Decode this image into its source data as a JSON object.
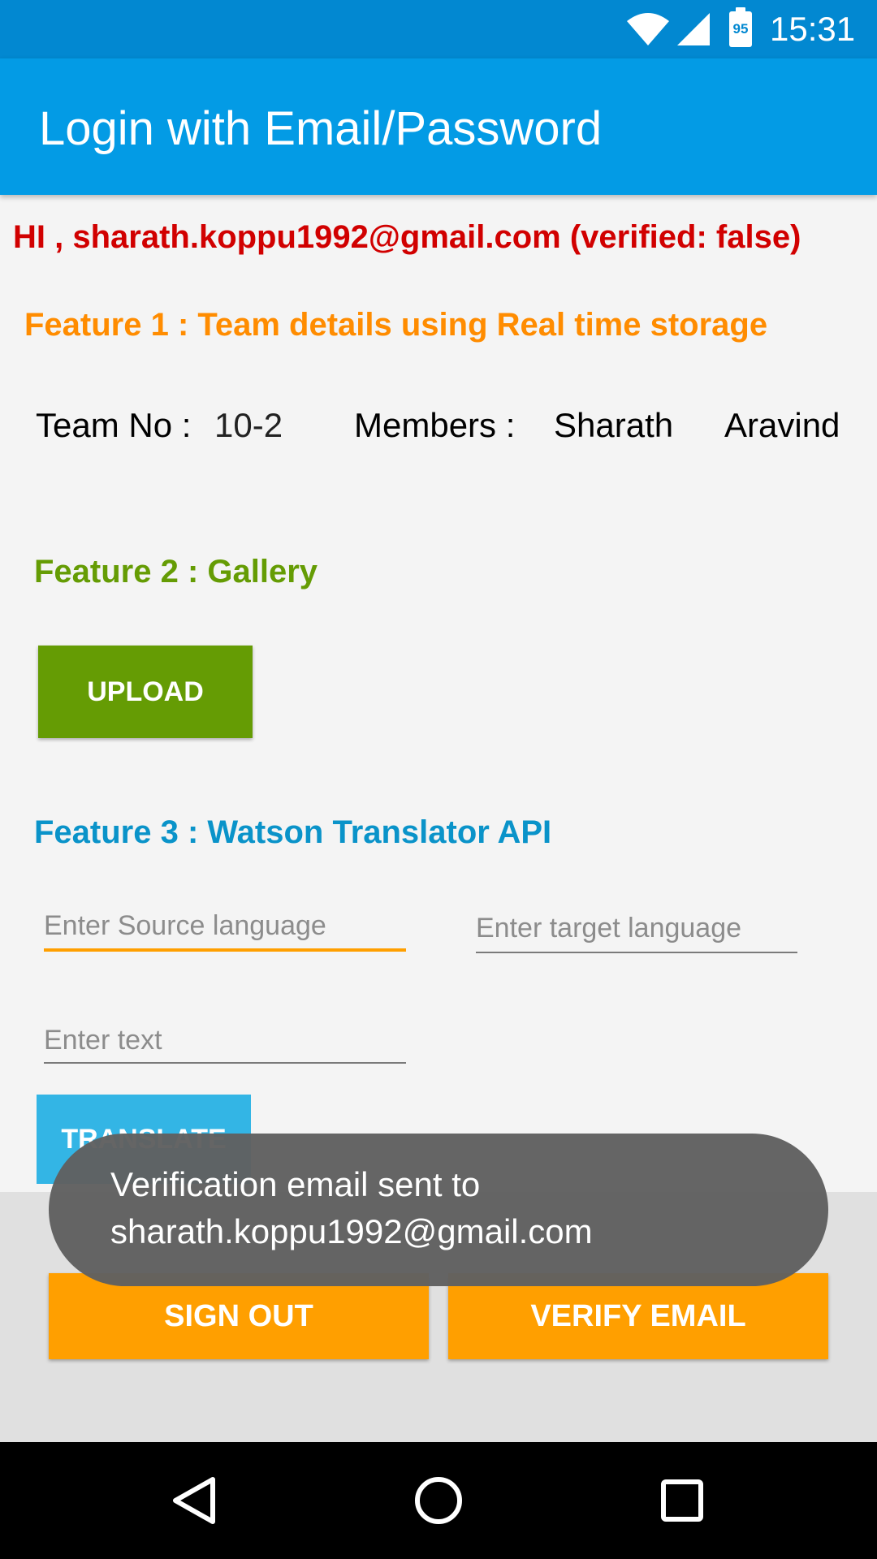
{
  "status_bar": {
    "time": "15:31",
    "battery_level": "95",
    "icons": [
      "wifi-icon",
      "cell-signal-icon",
      "battery-icon"
    ]
  },
  "app_bar": {
    "title": "Login with Email/Password"
  },
  "greeting": "HI , sharath.koppu1992@gmail.com (verified: false)",
  "feature1": {
    "title": "Feature 1 : Team details using Real time storage",
    "team_label": "Team No :",
    "team_no": "10-2",
    "members_label": "Members :",
    "members": [
      "Sharath",
      "Aravind"
    ]
  },
  "feature2": {
    "title": "Feature 2 : Gallery",
    "upload_label": "UPLOAD"
  },
  "feature3": {
    "title": "Feature 3 : Watson Translator API",
    "source_placeholder": "Enter Source language",
    "target_placeholder": "Enter target language",
    "text_placeholder": "Enter text",
    "translate_label": "TRANSLATE"
  },
  "actions": {
    "sign_out_label": "SIGN OUT",
    "verify_email_label": "VERIFY EMAIL"
  },
  "toast": {
    "line1": "Verification email sent to",
    "line2": "sharath.koppu1992@gmail.com"
  },
  "nav_bar": {
    "icons": [
      "back-icon",
      "home-icon",
      "recents-icon"
    ]
  },
  "colors": {
    "status_bar": "#0288d1",
    "app_bar": "#039be5",
    "greeting": "#d10000",
    "feature1": "#ff8c00",
    "feature2": "#659c04",
    "feature3": "#0a93c9",
    "accent_orange": "#ff9f00",
    "translate_button": "#33b5e5"
  }
}
